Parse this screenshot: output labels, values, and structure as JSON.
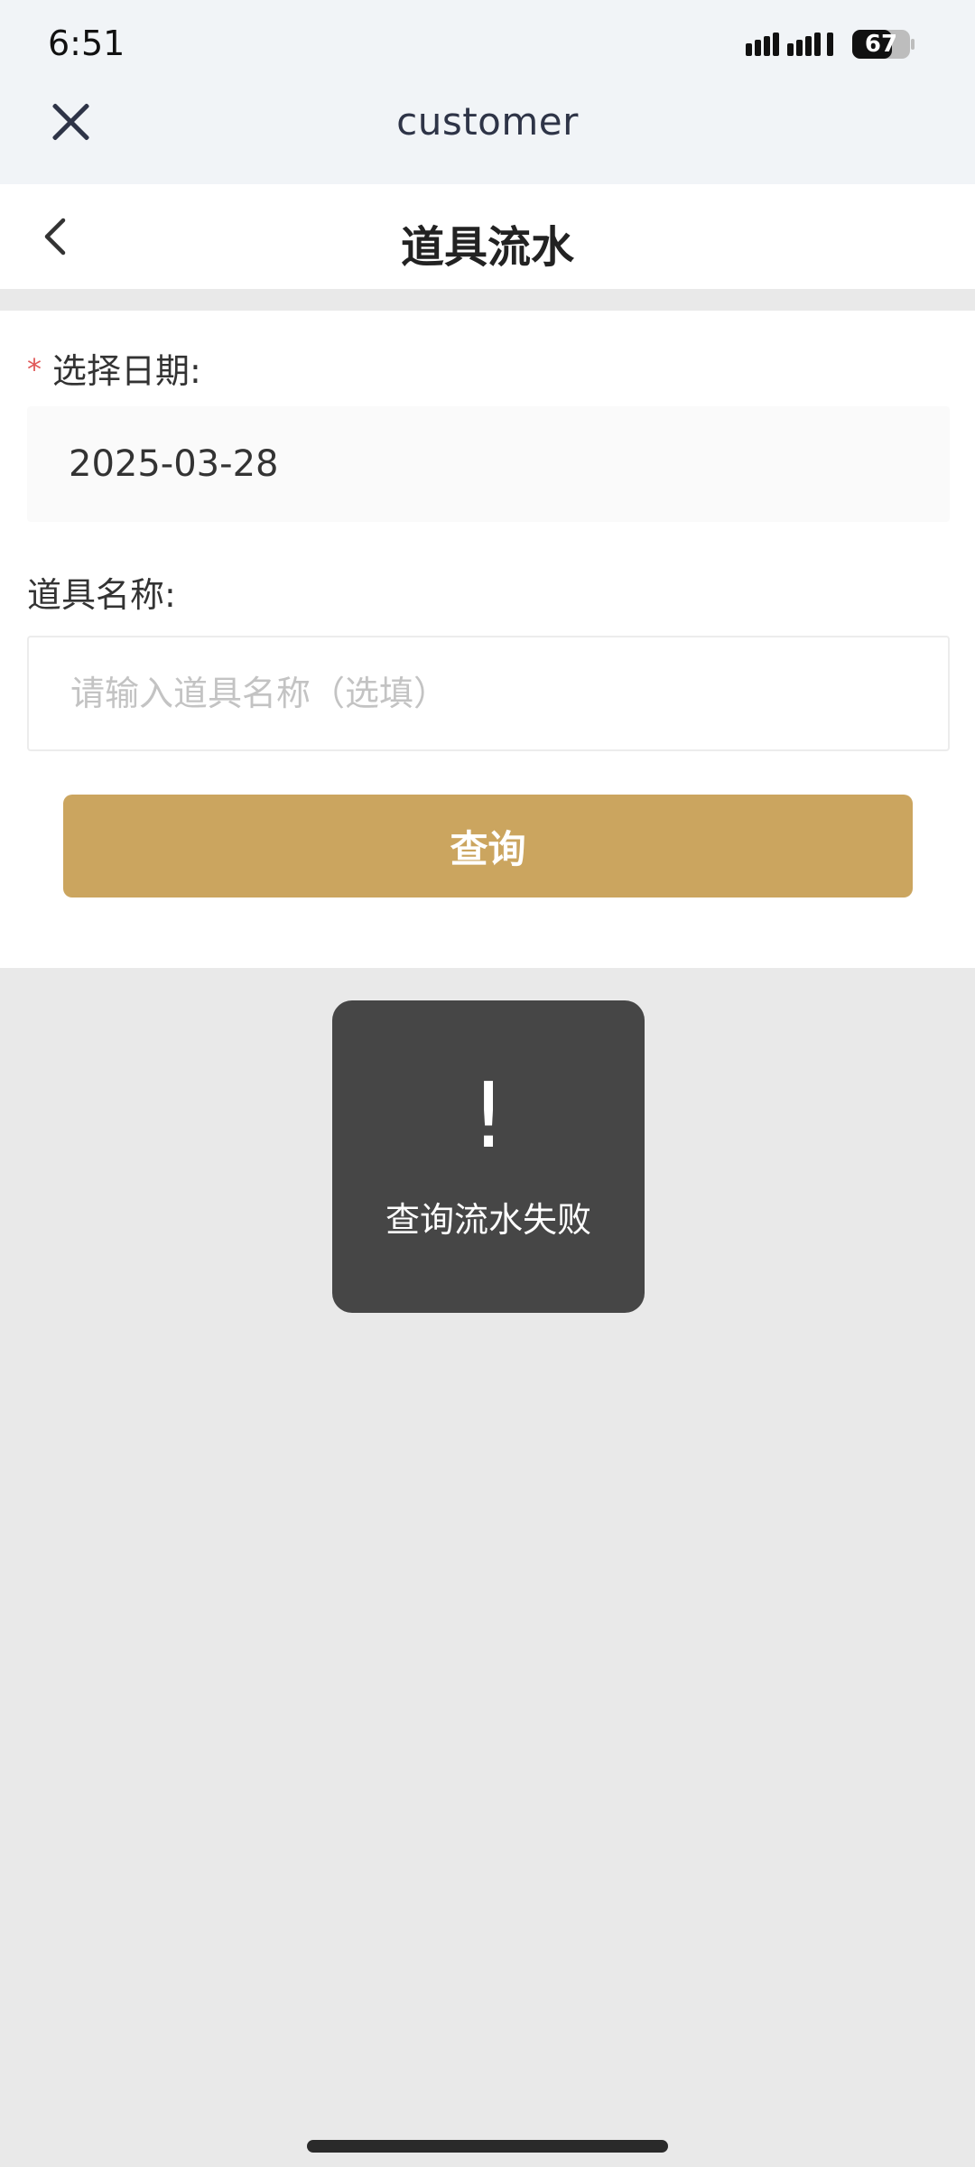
{
  "status_bar": {
    "time": "6:51",
    "battery_level": "67",
    "signal_icon": "signal-bars-icon",
    "battery_icon": "battery-icon"
  },
  "webview_header": {
    "title": "customer",
    "close_icon": "close-icon"
  },
  "navbar": {
    "title": "道具流水",
    "back_icon": "chevron-left-icon"
  },
  "form": {
    "date_label": "选择日期:",
    "required_mark": "*",
    "date_value": "2025-03-28",
    "name_label": "道具名称:",
    "name_placeholder": "请输入道具名称（选填）",
    "name_value": "",
    "query_button_label": "查询"
  },
  "toast": {
    "icon": "exclamation-icon",
    "icon_glyph": "!",
    "message": "查询流水失败"
  },
  "colors": {
    "accent": "#cba55f",
    "required": "#e05a5a",
    "toast_bg": "#464646",
    "chrome_bg": "#f1f4f7"
  }
}
